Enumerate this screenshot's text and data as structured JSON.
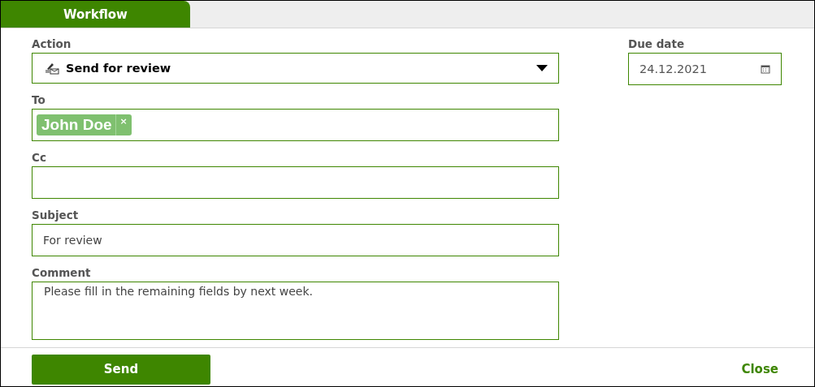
{
  "tabs": [
    {
      "label": "Workflow",
      "selected": true
    }
  ],
  "action": {
    "label": "Action",
    "value": "Send for review"
  },
  "to": {
    "label": "To",
    "recipients": [
      "John Doe"
    ],
    "remove": "×"
  },
  "cc": {
    "label": "Cc"
  },
  "subject": {
    "label": "Subject",
    "value": "For review"
  },
  "comment": {
    "label": "Comment",
    "value": "Please fill in the remaining fields by next week."
  },
  "due_date": {
    "label": "Due date",
    "value": "24.12.2021"
  },
  "buttons": {
    "send": "Send",
    "close": "Close"
  }
}
